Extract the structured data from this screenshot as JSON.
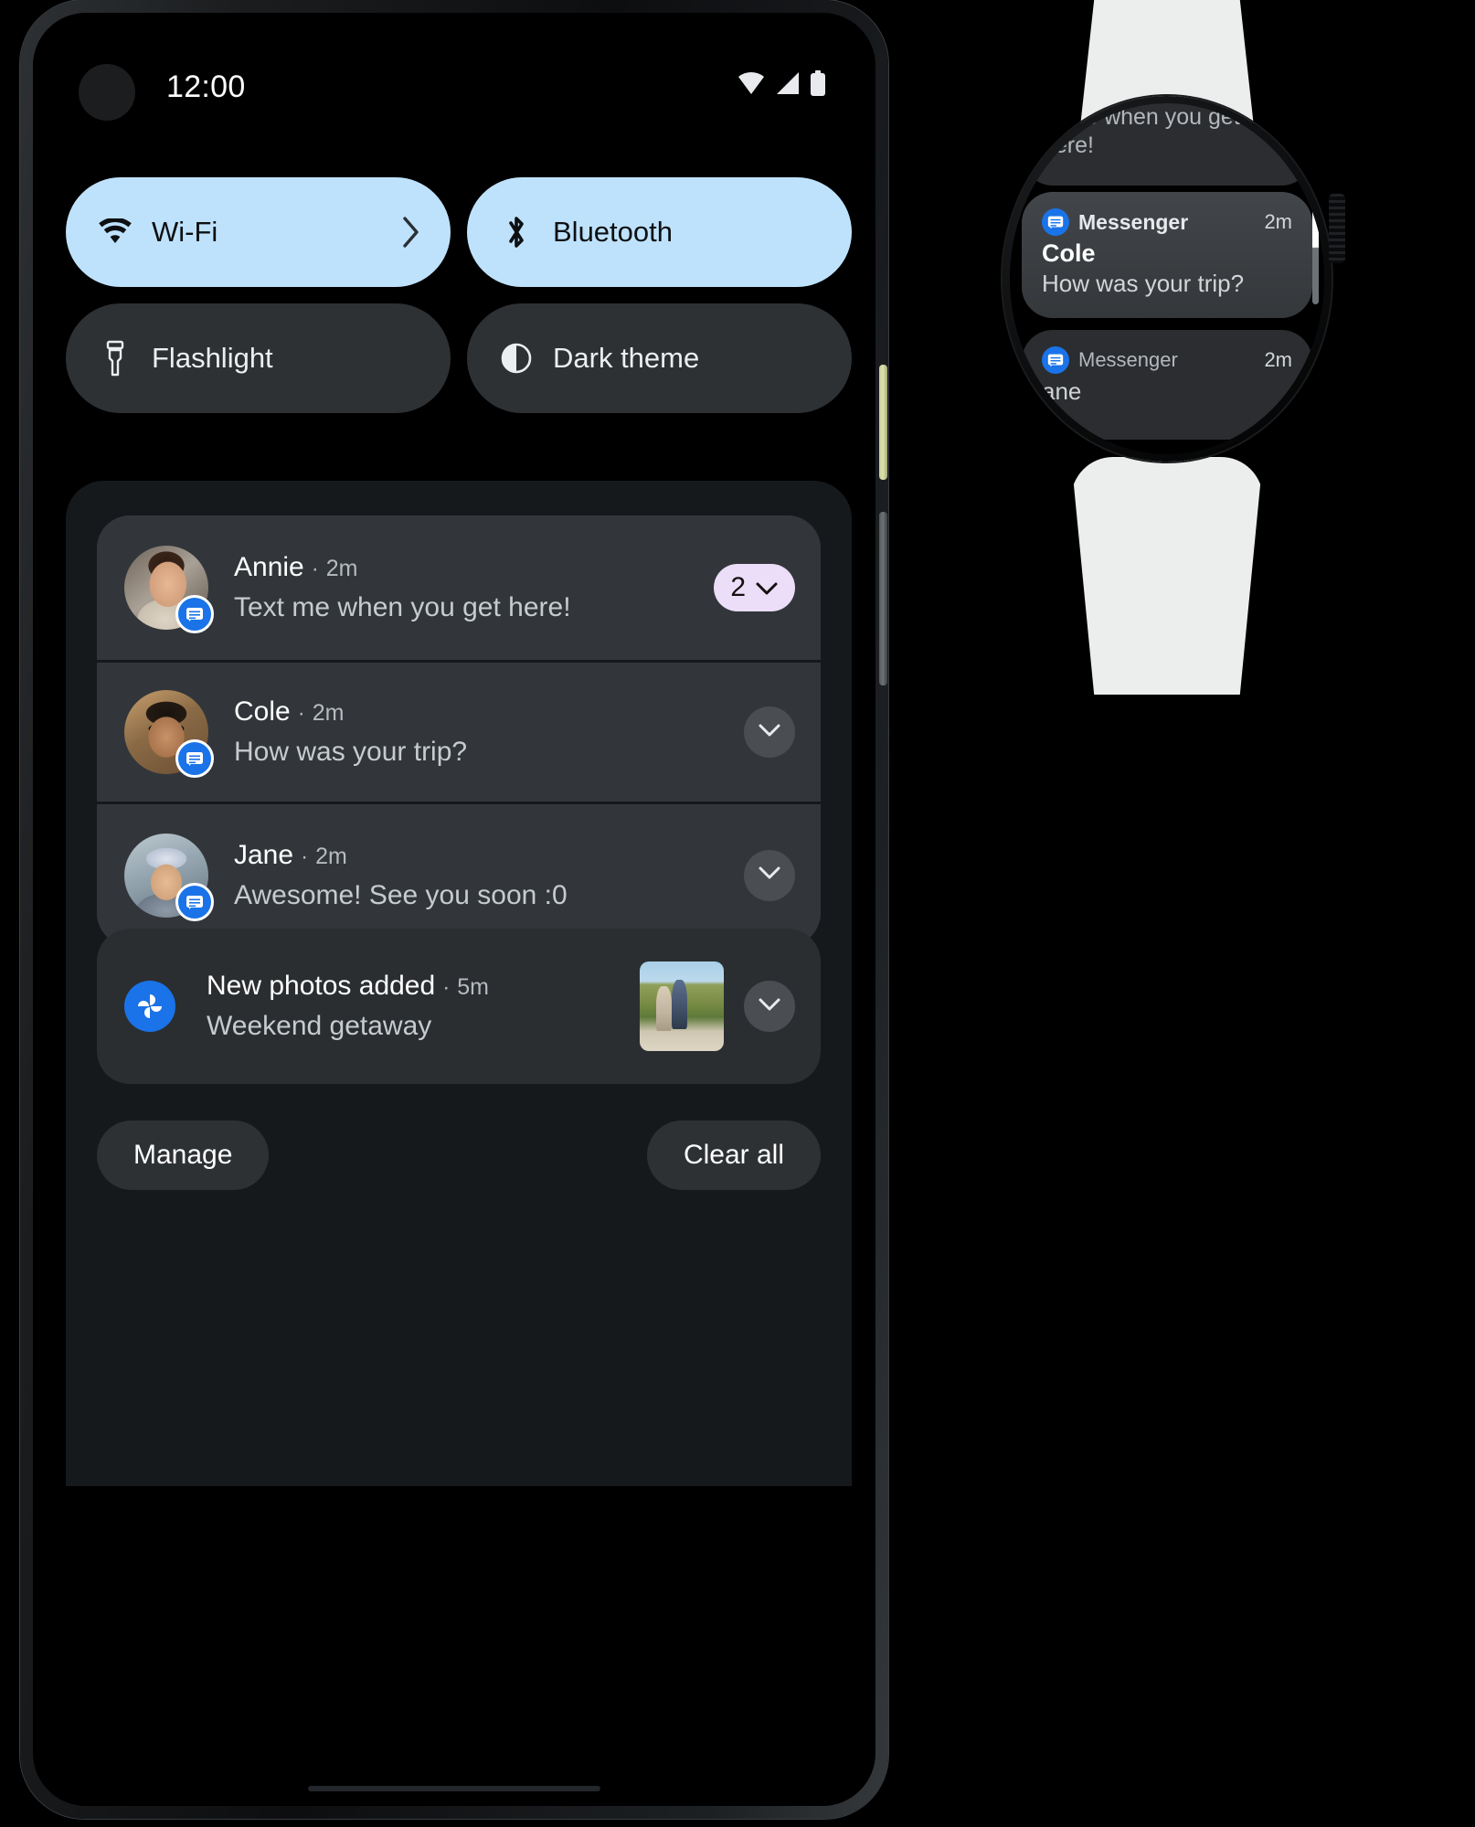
{
  "phone": {
    "status_bar": {
      "clock": "12:00",
      "icons": [
        "wifi-icon",
        "cell-signal-icon",
        "battery-icon"
      ]
    },
    "quick_settings": {
      "tiles": [
        {
          "label": "Wi-Fi",
          "icon": "wifi-icon",
          "state": "on",
          "has_chevron": true
        },
        {
          "label": "Bluetooth",
          "icon": "bluetooth-icon",
          "state": "on",
          "has_chevron": false
        },
        {
          "label": "Flashlight",
          "icon": "flashlight-icon",
          "state": "off",
          "has_chevron": false
        },
        {
          "label": "Dark theme",
          "icon": "dark-theme-icon",
          "state": "off",
          "has_chevron": false
        }
      ],
      "colors": {
        "tile_on_bg": "#bfe2fc",
        "tile_on_fg": "#0d1012",
        "tile_off_bg": "#2e3134",
        "tile_off_fg": "#eceff1"
      }
    },
    "notifications": {
      "messages": [
        {
          "sender": "Annie",
          "separator": "·",
          "time": "2m",
          "message": "Text me when you get here!",
          "app_icon": "messages-icon",
          "count_badge": "2",
          "avatar": "annie-avatar"
        },
        {
          "sender": "Cole",
          "separator": "·",
          "time": "2m",
          "message": "How was your trip?",
          "app_icon": "messages-icon",
          "count_badge": null,
          "avatar": "cole-avatar"
        },
        {
          "sender": "Jane",
          "separator": "·",
          "time": "2m",
          "message": "Awesome! See you soon :0",
          "app_icon": "messages-icon",
          "count_badge": null,
          "avatar": "jane-avatar"
        }
      ],
      "photos": {
        "title": "New photos added",
        "separator": "·",
        "time": "5m",
        "subtitle": "Weekend getaway",
        "app_icon": "google-photos-icon",
        "thumbnail": "weekend-getaway-thumbnail"
      },
      "actions": {
        "manage": "Manage",
        "clear_all": "Clear all"
      },
      "colors": {
        "badge_bg": "#ecddf8",
        "badge_fg": "#13100e",
        "card_bg": "#32363a",
        "shade_bg": "#16191c"
      }
    },
    "hardware": {
      "power_button_color": "#dde2ae",
      "volume_button_color": "#6d7276"
    }
  },
  "watch": {
    "cards": [
      {
        "id": "previous",
        "app": null,
        "time": null,
        "sender": null,
        "message": "xt me when you get here!"
      },
      {
        "id": "current",
        "app": "Messenger",
        "time": "2m",
        "sender": "Cole",
        "message": "How was your trip?",
        "app_icon": "messages-icon"
      },
      {
        "id": "next",
        "app": "Messenger",
        "time": "2m",
        "sender": "ane",
        "message": "",
        "app_icon": "messages-icon"
      }
    ],
    "band_color": "#eceded",
    "scroll_indicator": "scroll-position-indicator"
  }
}
